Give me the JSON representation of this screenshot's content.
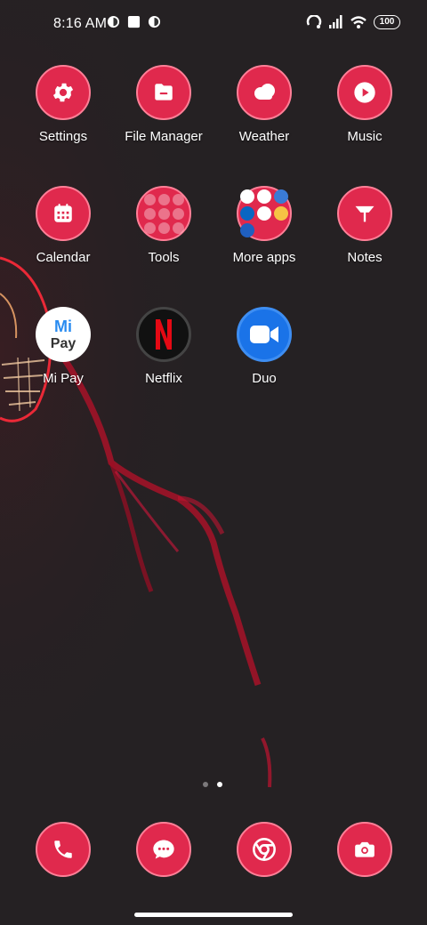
{
  "status_bar": {
    "time": "8:16 AM",
    "battery": "100",
    "icons": [
      "notification-icon",
      "square-notification-icon",
      "notification-icon",
      "hotspot-icon",
      "signal-icon",
      "wifi-icon",
      "battery-icon"
    ]
  },
  "apps": [
    {
      "label": "Settings",
      "icon": "gear-icon"
    },
    {
      "label": "File Manager",
      "icon": "folder-icon"
    },
    {
      "label": "Weather",
      "icon": "cloud-icon"
    },
    {
      "label": "Music",
      "icon": "play-icon"
    },
    {
      "label": "Calendar",
      "icon": "calendar-icon"
    },
    {
      "label": "Tools",
      "icon": "folder-grid-icon"
    },
    {
      "label": "More apps",
      "icon": "folder-grid-icon"
    },
    {
      "label": "Notes",
      "icon": "notes-icon"
    },
    {
      "label": "Mi Pay",
      "icon": "mi-pay-icon"
    },
    {
      "label": "Netflix",
      "icon": "netflix-icon"
    },
    {
      "label": "Duo",
      "icon": "video-camera-icon"
    }
  ],
  "dock": [
    "phone-icon",
    "messages-icon",
    "chrome-icon",
    "camera-icon"
  ],
  "page_indicator": {
    "pages": 2,
    "current": 2
  },
  "colors": {
    "accent": "#e0294d",
    "ring": "#ff7f97",
    "background": "#242022"
  }
}
